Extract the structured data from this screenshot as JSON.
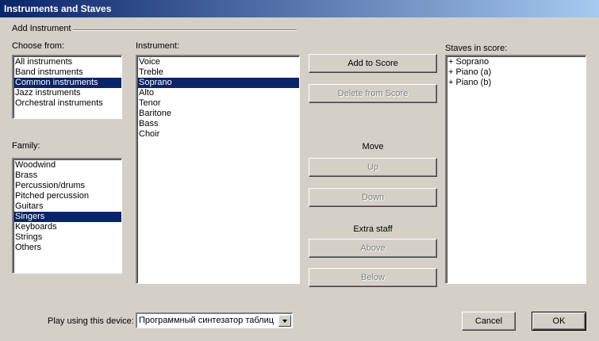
{
  "window": {
    "title": "Instruments and Staves"
  },
  "group": {
    "label": "Add Instrument"
  },
  "choose_from": {
    "label": "Choose from:",
    "items": [
      "All instruments",
      "Band instruments",
      "Common instruments",
      "Jazz instruments",
      "Orchestral instruments"
    ],
    "selected": "Common instruments"
  },
  "family": {
    "label": "Family:",
    "items": [
      "Woodwind",
      "Brass",
      "Percussion/drums",
      "Pitched percussion",
      "Guitars",
      "Singers",
      "Keyboards",
      "Strings",
      "Others"
    ],
    "selected": "Singers"
  },
  "instrument": {
    "label": "Instrument:",
    "items": [
      "Voice",
      "Treble",
      "Soprano",
      "Alto",
      "Tenor",
      "Baritone",
      "Bass",
      "Choir"
    ],
    "selected": "Soprano"
  },
  "staves": {
    "label": "Staves in score:",
    "items": [
      "+ Soprano",
      "+ Piano (a)",
      "+ Piano (b)"
    ]
  },
  "buttons": {
    "add_to_score": "Add to Score",
    "delete_from_score": "Delete from Score",
    "move_caption": "Move",
    "up": "Up",
    "down": "Down",
    "extra_staff_caption": "Extra staff",
    "above": "Above",
    "below": "Below",
    "cancel": "Cancel",
    "ok": "OK"
  },
  "device": {
    "label": "Play using this device:",
    "value": "Программный синтезатор таблиц"
  }
}
